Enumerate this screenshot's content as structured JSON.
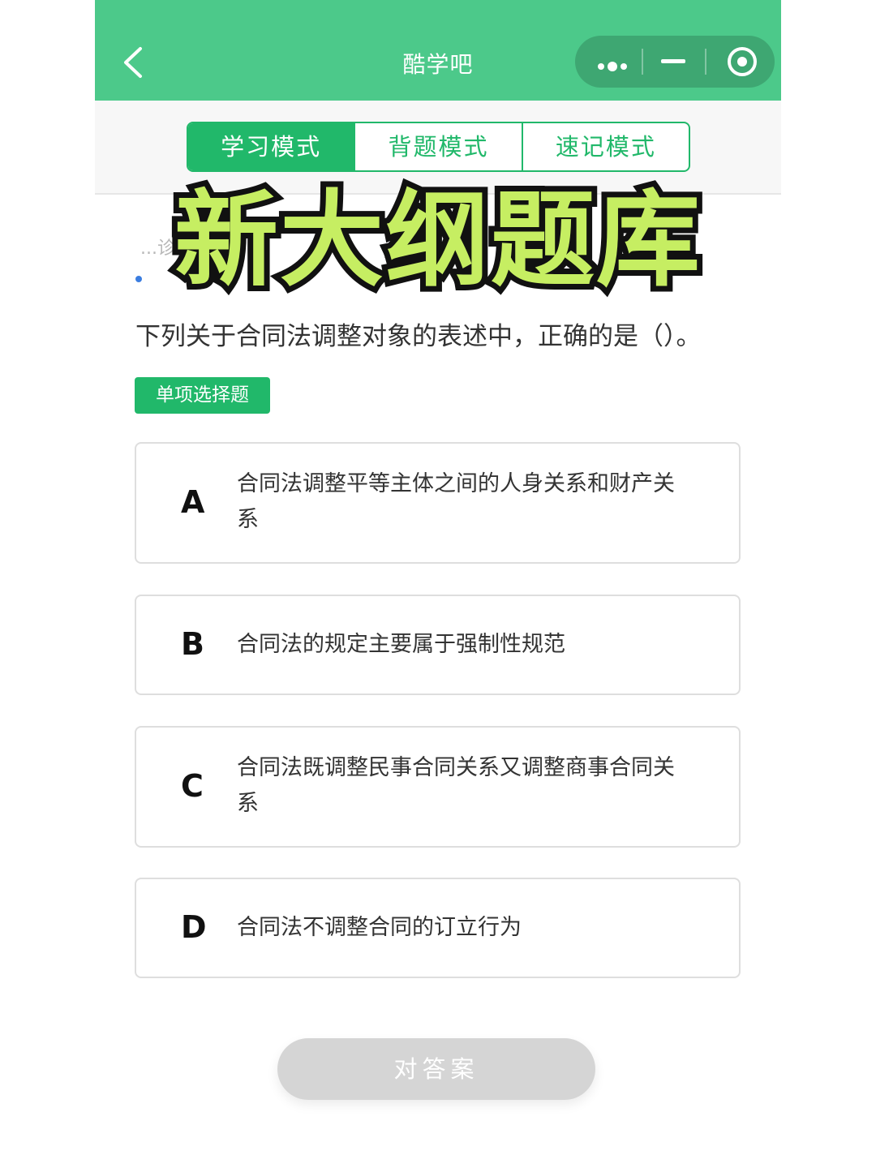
{
  "header": {
    "title": "酷学吧",
    "back_icon": "chevron-left-icon",
    "capsule": [
      "more-dots-icon",
      "minimize-icon",
      "close-target-icon"
    ],
    "color": "#4cc98a"
  },
  "modes": {
    "tabs": [
      {
        "label": "学习模式",
        "active": true
      },
      {
        "label": "背题模式",
        "active": false
      },
      {
        "label": "速记模式",
        "active": false
      }
    ],
    "accent": "#21b86a"
  },
  "overlay": {
    "title": "新大纲题库"
  },
  "partial_text": "...诊断...的...",
  "question": {
    "text": "下列关于合同法调整对象的表述中，正确的是（）。",
    "type": "单项选择题",
    "options": [
      {
        "letter": "A",
        "text": "合同法调整平等主体之间的人身关系和财产关系"
      },
      {
        "letter": "B",
        "text": "合同法的规定主要属于强制性规范"
      },
      {
        "letter": "C",
        "text": "合同法既调整民事合同关系又调整商事合同关系"
      },
      {
        "letter": "D",
        "text": "合同法不调整合同的订立行为"
      }
    ]
  },
  "actions": {
    "check_answer": "对答案"
  }
}
